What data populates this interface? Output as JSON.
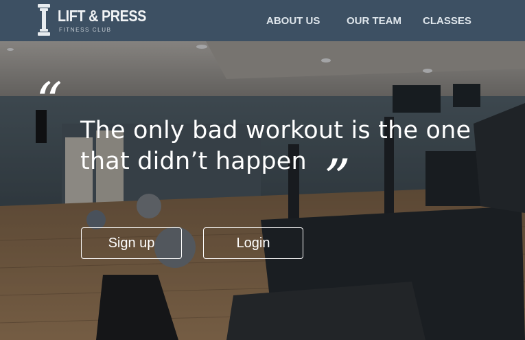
{
  "brand": {
    "name": "LIFT & PRESS",
    "tagline": "FITNESS CLUB",
    "logo_icon": "dumbbell-icon"
  },
  "nav": {
    "items": [
      {
        "label": "ABOUT US"
      },
      {
        "label": "OUR TEAM"
      },
      {
        "label": "CLASSES"
      }
    ]
  },
  "hero": {
    "quote_open": "“",
    "quote_text": "The only bad workout is the one that didn’t happen",
    "quote_close": "”",
    "background": "home-gym-photo"
  },
  "actions": {
    "signup_label": "Sign up",
    "login_label": "Login"
  },
  "colors": {
    "navbar": "#3d5063",
    "text": "#ffffff"
  }
}
